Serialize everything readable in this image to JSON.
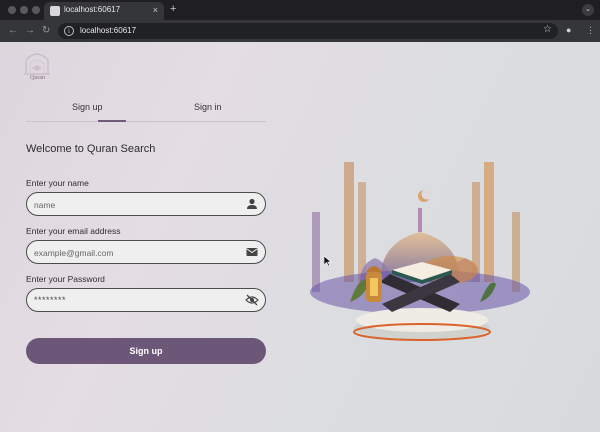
{
  "browser": {
    "tab_title": "localhost:60617",
    "url": "localhost:60617",
    "new_tab_symbol": "+",
    "tab_close_symbol": "×",
    "icons": [
      "back-arrow-icon",
      "forward-arrow-icon",
      "reload-icon",
      "info-icon",
      "star-icon",
      "profile-icon",
      "more-menu-icon"
    ]
  },
  "app": {
    "logo_text": "Quran",
    "tabs": [
      {
        "label": "Sign up",
        "active": true
      },
      {
        "label": "Sign in",
        "active": false
      }
    ],
    "welcome": "Welcome to Quran Search",
    "form": {
      "name_label": "Enter your name",
      "name_placeholder": "name",
      "email_label": "Enter your email address",
      "email_placeholder": "example@gmail.com",
      "password_label": "Enter your Password",
      "password_value": "********",
      "submit_label": "Sign up"
    },
    "colors": {
      "accent": "#6c5779",
      "tab_indicator": "#6f5a7e"
    }
  }
}
